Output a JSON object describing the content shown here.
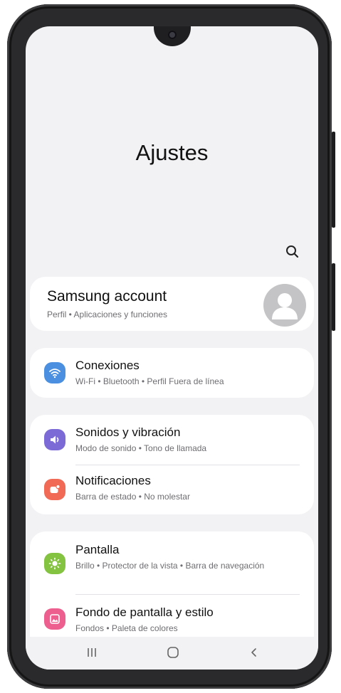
{
  "header": {
    "title": "Ajustes",
    "search_icon": "search-icon"
  },
  "account": {
    "title": "Samsung account",
    "subtitle": "Perfil • Aplicaciones y funciones",
    "avatar_icon": "person-icon"
  },
  "items": [
    {
      "title": "Conexiones",
      "subtitle": "Wi-Fi • Bluetooth • Perfil Fuera de línea",
      "icon": "wifi-icon",
      "color": "#4a8fe0"
    },
    {
      "title": "Sonidos y vibración",
      "subtitle": "Modo de sonido • Tono de llamada",
      "icon": "volume-icon",
      "color": "#7c6bd6"
    },
    {
      "title": "Notificaciones",
      "subtitle": "Barra de estado • No molestar",
      "icon": "notification-icon",
      "color": "#f06a55"
    },
    {
      "title": "Pantalla",
      "subtitle": "Brillo • Protector de la vista • Barra de navegación",
      "icon": "brightness-icon",
      "color": "#84c341"
    },
    {
      "title": "Fondo de pantalla y estilo",
      "subtitle": "Fondos • Paleta de colores",
      "icon": "wallpaper-icon",
      "color": "#ec5f8e"
    }
  ],
  "nav": {
    "recent_icon": "recent-apps-icon",
    "home_icon": "home-icon",
    "back_icon": "back-icon"
  },
  "colors": {
    "screen_background": "#f2f2f4",
    "card_background": "#ffffff",
    "avatar": "#c4c4c6"
  }
}
